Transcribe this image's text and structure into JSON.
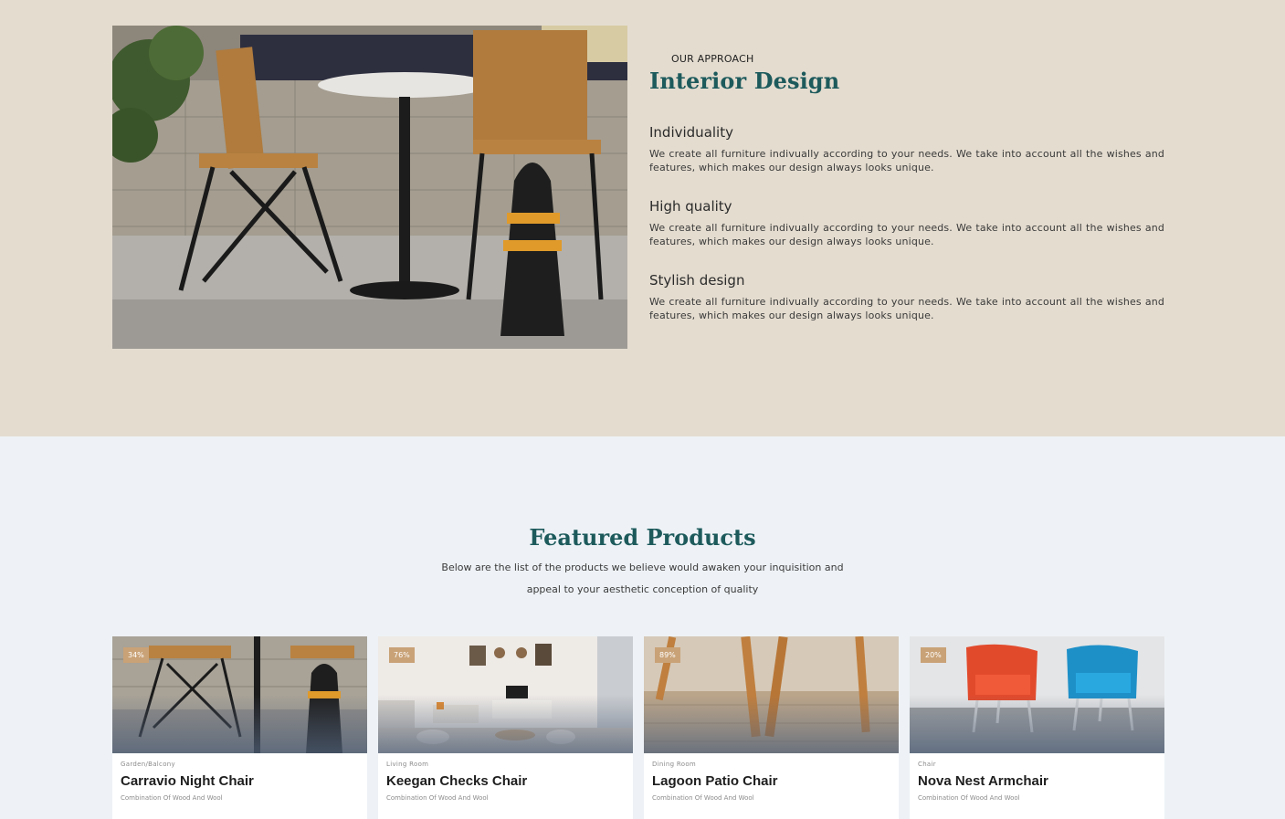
{
  "approach": {
    "eyebrow": "OUR APPROACH",
    "title": "Interior Design",
    "photo_icon": "patio-table-chairs-photo",
    "features": [
      {
        "title": "Individuality",
        "description": "We create all furniture indivually according to your needs. We take into account all the wishes and features, which makes our design always looks unique."
      },
      {
        "title": "High quality",
        "description": "We create all furniture indivually according to your needs. We take into account all the wishes and features, which makes our design always looks unique."
      },
      {
        "title": "Stylish design",
        "description": "We create all furniture indivually according to your needs. We take into account all the wishes and features, which makes our design always looks unique."
      }
    ]
  },
  "featured": {
    "title": "Featured Products",
    "subtitle_line1": "Below are the list of the products we believe would awaken your inquisition and",
    "subtitle_line2": "appeal to your aesthetic conception of quality",
    "products": [
      {
        "badge": "34%",
        "category": "Garden/Balcony",
        "name": "Carravio Night Chair",
        "description": "Combination Of Wood And Wool",
        "image": "patio-chair-photo"
      },
      {
        "badge": "76%",
        "category": "Living Room",
        "name": "Keegan Checks Chair",
        "description": "Combination Of Wood And Wool",
        "image": "living-room-photo"
      },
      {
        "badge": "89%",
        "category": "Dining Room",
        "name": "Lagoon Patio Chair",
        "description": "Combination Of Wood And Wool",
        "image": "wooden-chair-legs-photo"
      },
      {
        "badge": "20%",
        "category": "Chair",
        "name": "Nova Nest Armchair",
        "description": "Combination Of Wood And Wool",
        "image": "armchairs-photo"
      }
    ]
  },
  "colors": {
    "approach_bg": "#e4dccf",
    "featured_bg": "#eef2f6",
    "heading": "#1d5a5c",
    "badge": "#c9a277"
  }
}
